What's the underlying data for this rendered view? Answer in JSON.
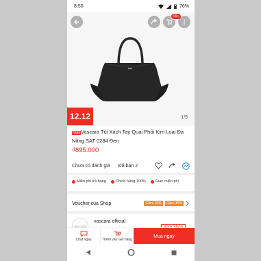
{
  "status_bar": {
    "time": "8:50",
    "battery": "76%"
  },
  "header": {
    "cart_badge": "99+"
  },
  "product": {
    "promo_tag": "12.12",
    "image_counter": "1/5",
    "mall_tag": "Mall",
    "title": "Vascara Túi Xách Tay Quai Phối Kim Loại Đa Năng SAT 0284 Đen",
    "price": "₫895.000",
    "rating_text": "Chưa có đánh giá",
    "sold_text": "Đã bán 2"
  },
  "guarantees": [
    {
      "label": "Miễn phí trả hàng"
    },
    {
      "label": "Chính hãng 100%"
    },
    {
      "label": "Giao miễn phí"
    }
  ],
  "voucher": {
    "label": "Voucher của Shop",
    "tags": [
      "Giảm 15%",
      "Giảm 15%"
    ]
  },
  "shop": {
    "name": "vascara official",
    "avatar_text": "VASCARA",
    "view_label": "Xem Shop"
  },
  "bottom_bar": {
    "chat_label": "Chat ngay",
    "cart_label": "Thêm vào Giỏ hàng",
    "buy_label": "Mua ngay"
  },
  "colors": {
    "brand": "#ee2e24",
    "voucher": "#f28c28"
  },
  "icons": [
    "back-icon",
    "share-icon",
    "cart-icon",
    "more-icon",
    "heart-icon",
    "share-outline-icon",
    "messenger-icon",
    "chevron-right-icon",
    "chat-icon",
    "add-cart-icon",
    "nav-back-icon",
    "nav-home-icon",
    "nav-recent-icon",
    "wifi-icon",
    "signal-icon",
    "battery-icon"
  ]
}
